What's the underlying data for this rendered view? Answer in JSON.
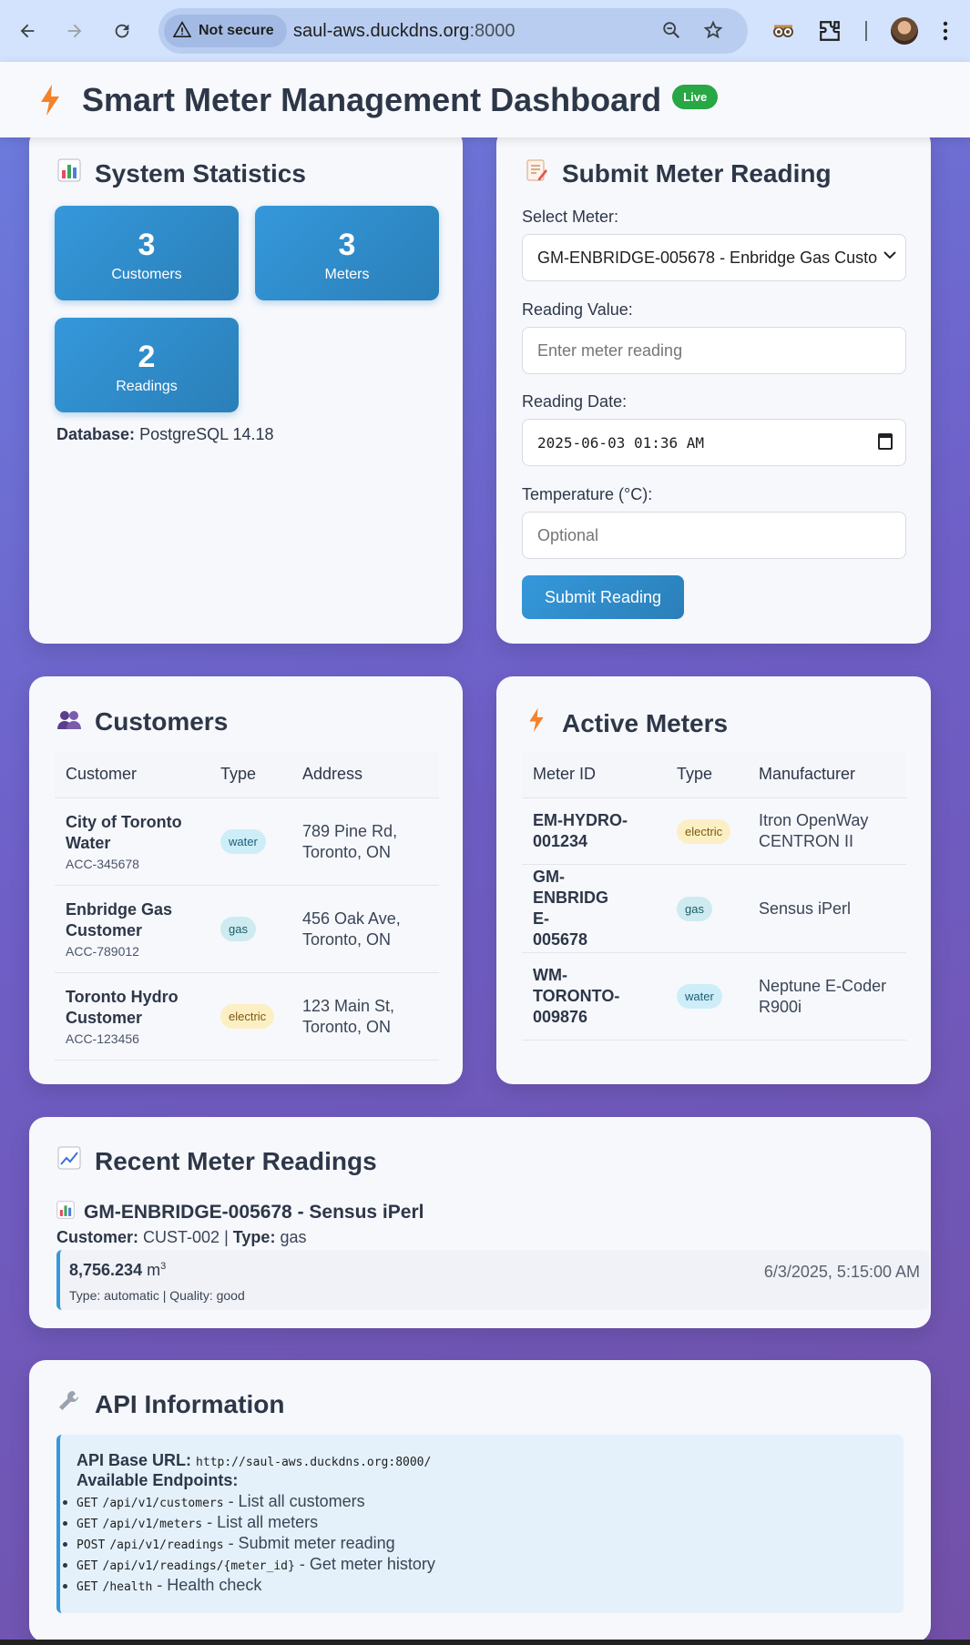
{
  "browser": {
    "security_label": "Not secure",
    "url_host": "saul-aws.duckdns.org",
    "url_port": ":8000"
  },
  "header": {
    "title": "Smart Meter Management Dashboard",
    "live_badge": "Live"
  },
  "stats": {
    "title": "System Statistics",
    "items": [
      {
        "value": "3",
        "label": "Customers"
      },
      {
        "value": "3",
        "label": "Meters"
      },
      {
        "value": "2",
        "label": "Readings"
      }
    ],
    "database_label": "Database:",
    "database_value": "PostgreSQL 14.18"
  },
  "form": {
    "title": "Submit Meter Reading",
    "select_label": "Select Meter:",
    "select_value": "GM-ENBRIDGE-005678 - Enbridge Gas Custo",
    "reading_label": "Reading Value:",
    "reading_placeholder": "Enter meter reading",
    "date_label": "Reading Date:",
    "date_value": "2025-06-03 01:36 AM",
    "temp_label": "Temperature (°C):",
    "temp_placeholder": "Optional",
    "submit_label": "Submit Reading"
  },
  "customers": {
    "title": "Customers",
    "headers": [
      "Customer",
      "Type",
      "Address"
    ],
    "rows": [
      {
        "name": "City of Toronto Water",
        "account": "ACC-345678",
        "type": "water",
        "address": "789 Pine Rd, Toronto, ON"
      },
      {
        "name": "Enbridge Gas Customer",
        "account": "ACC-789012",
        "type": "gas",
        "address": "456 Oak Ave, Toronto, ON"
      },
      {
        "name": "Toronto Hydro Customer",
        "account": "ACC-123456",
        "type": "electric",
        "address": "123 Main St, Toronto, ON"
      }
    ]
  },
  "meters": {
    "title": "Active Meters",
    "headers": [
      "Meter ID",
      "Type",
      "Manufacturer"
    ],
    "rows": [
      {
        "id": "EM-HYDRO-001234",
        "type": "electric",
        "manufacturer": "Itron OpenWay CENTRON II"
      },
      {
        "id": "GM-ENBRIDGE-005678",
        "type": "gas",
        "manufacturer": "Sensus iPerl"
      },
      {
        "id": "WM-TORONTO-009876",
        "type": "water",
        "manufacturer": "Neptune E-Coder R900i"
      }
    ]
  },
  "readings": {
    "title": "Recent Meter Readings",
    "meter_heading": "GM-ENBRIDGE-005678 - Sensus iPerl",
    "customer_label": "Customer:",
    "customer_value": "CUST-002",
    "type_label": "Type:",
    "type_value": "gas",
    "value": "8,756.234",
    "unit": "m",
    "unit_sup": "3",
    "meta": "Type: automatic | Quality: good",
    "timestamp": "6/3/2025, 5:15:00 AM"
  },
  "api": {
    "title": "API Information",
    "base_label": "API Base URL:",
    "base_url": "http://saul-aws.duckdns.org:8000/",
    "endpoints_label": "Available Endpoints:",
    "endpoints": [
      {
        "method": "GET",
        "path": "/api/v1/customers",
        "desc": " - List all customers"
      },
      {
        "method": "GET",
        "path": "/api/v1/meters",
        "desc": " - List all meters"
      },
      {
        "method": "POST",
        "path": "/api/v1/readings",
        "desc": " - Submit meter reading"
      },
      {
        "method": "GET",
        "path": "/api/v1/readings/{meter_id}",
        "desc": " - Get meter history"
      },
      {
        "method": "GET",
        "path": "/health",
        "desc": " - Health check"
      }
    ]
  },
  "colors": {
    "accent": "#3598db",
    "live": "#28a745",
    "heading": "#2d3748"
  },
  "icons": {
    "header": "lightning-bolt-icon",
    "stats": "bar-chart-icon",
    "form": "memo-icon",
    "customers": "people-icon",
    "meters": "lightning-bolt-icon",
    "readings": "line-chart-icon",
    "api": "wrench-icon"
  }
}
